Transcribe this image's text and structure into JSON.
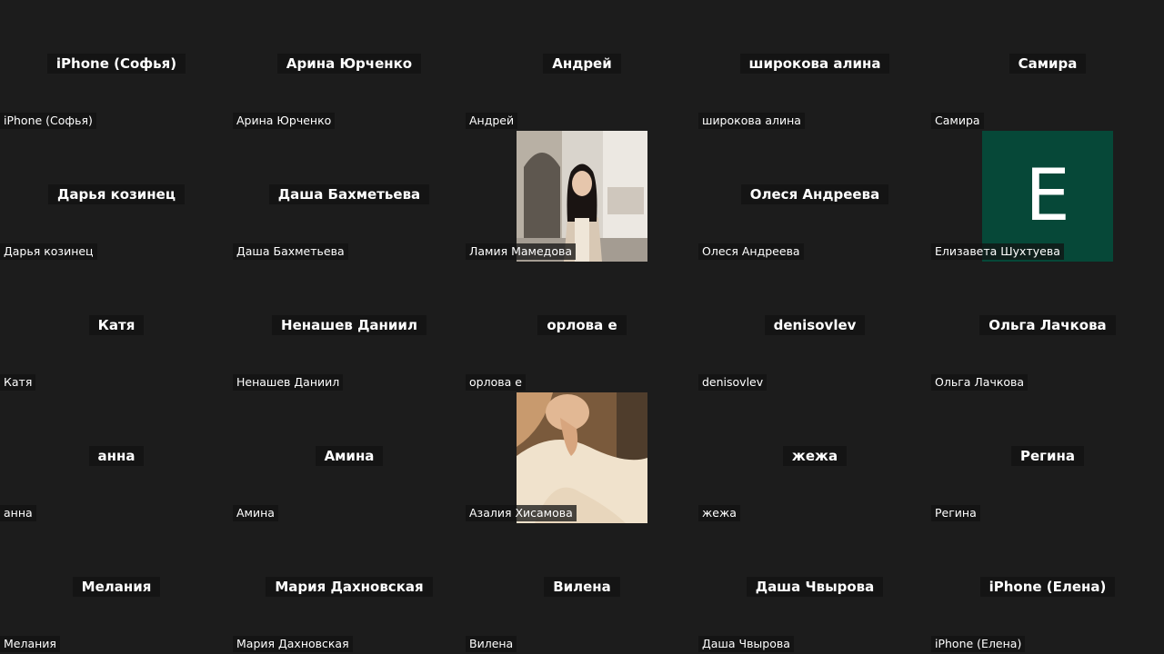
{
  "app": {
    "background": "#1c1c1c"
  },
  "participants": [
    {
      "title": "iPhone (Софья)",
      "name": "iPhone (Софья)",
      "type": "name"
    },
    {
      "title": "Арина Юрченко",
      "name": "Арина Юрченко",
      "type": "name"
    },
    {
      "title": "Андрей",
      "name": "Андрей",
      "type": "name"
    },
    {
      "title": "широкова алина",
      "name": "широкова алина",
      "type": "name"
    },
    {
      "title": "Самира",
      "name": "Самира",
      "type": "name"
    },
    {
      "title": "Дарья козинец",
      "name": "Дарья козинец",
      "type": "name"
    },
    {
      "title": "Даша Бахметьева",
      "name": "Даша Бахметьева",
      "type": "name"
    },
    {
      "title": "",
      "name": "Ламия Мамедова",
      "type": "video",
      "video_icon": "person-photo-long-hair"
    },
    {
      "title": "Олеся Андреева",
      "name": "Олеся Андреева",
      "type": "name"
    },
    {
      "title": "",
      "name": "Елизавета Шухтуева",
      "type": "avatar",
      "avatar_letter": "E",
      "avatar_color": "#064838"
    },
    {
      "title": "Катя",
      "name": "Катя",
      "type": "name"
    },
    {
      "title": "Ненашев Даниил",
      "name": "Ненашев Даниил",
      "type": "name"
    },
    {
      "title": "орлова е",
      "name": "орлова е",
      "type": "name"
    },
    {
      "title": "denisovlev",
      "name": "denisovlev",
      "type": "name"
    },
    {
      "title": "Ольга Лачкова",
      "name": "Ольга Лачкова",
      "type": "name"
    },
    {
      "title": "анна",
      "name": "анна",
      "type": "name"
    },
    {
      "title": "Амина",
      "name": "Амина",
      "type": "name"
    },
    {
      "title": "",
      "name": "Азалия Хисамова",
      "type": "video",
      "video_icon": "person-photo-white-sweater"
    },
    {
      "title": "жежа",
      "name": "жежа",
      "type": "name"
    },
    {
      "title": "Регина",
      "name": "Регина",
      "type": "name"
    },
    {
      "title": "Мелания",
      "name": "Мелания",
      "type": "name"
    },
    {
      "title": "Мария  Дахновская",
      "name": "Мария Дахновская",
      "type": "name"
    },
    {
      "title": "Вилена",
      "name": "Вилена",
      "type": "name"
    },
    {
      "title": "Даша Чвырова",
      "name": "Даша Чвырова",
      "type": "name"
    },
    {
      "title": "iPhone (Елена)",
      "name": "iPhone (Елена)",
      "type": "name"
    }
  ]
}
